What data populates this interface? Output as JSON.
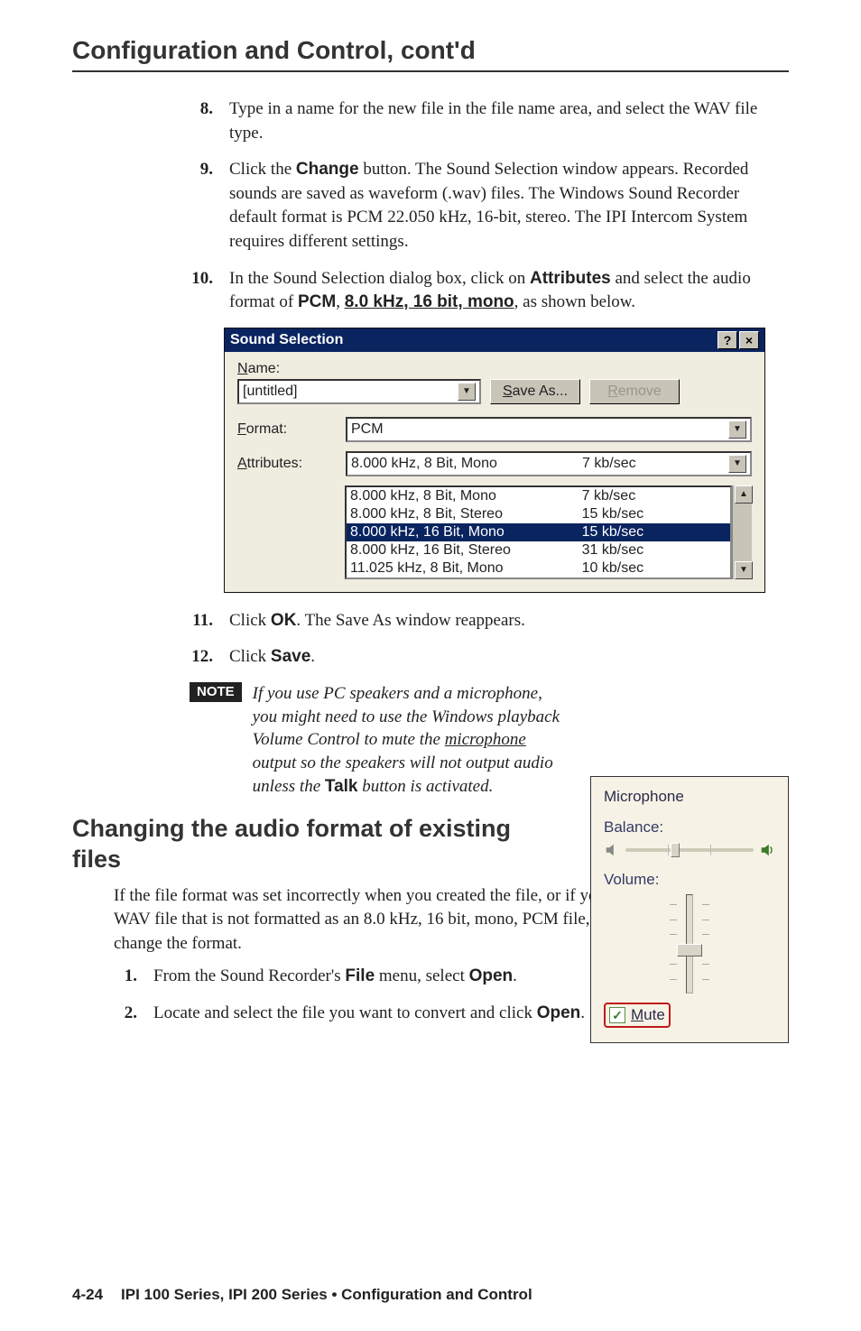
{
  "header": "Configuration and Control, cont'd",
  "steps_a": [
    {
      "num": "8.",
      "text": "Type in a name for the new file in the file name area, and select the WAV file type."
    },
    {
      "num": "9.",
      "pre": "Click the ",
      "bold": "Change",
      "post": " button.  The Sound Selection window appears.  Recorded sounds are saved as waveform (.wav) files.  The Windows Sound Recorder default format is PCM 22.050 kHz, 16-bit, stereo.  The IPI Intercom System requires different settings."
    },
    {
      "num": "10.",
      "pre": "In the Sound Selection dialog box, click on ",
      "bold": "Attributes",
      "mid": " and select the audio format of ",
      "bold2": "PCM",
      "sep": ", ",
      "ubold": "8.0 kHz, 16 bit, mono",
      "post2": ", as shown below."
    }
  ],
  "dialog": {
    "title": "Sound Selection",
    "help": "?",
    "close": "×",
    "name_label_u": "N",
    "name_label_rest": "ame:",
    "name_value": "[untitled]",
    "saveas_u": "S",
    "saveas_rest": "ave As...",
    "remove_u": "R",
    "remove_rest": "emove",
    "format_u": "F",
    "format_rest": "ormat:",
    "format_value": "PCM",
    "attr_u": "A",
    "attr_rest": "ttributes:",
    "attr_value": "8.000 kHz, 8 Bit, Mono",
    "attr_rate": "7 kb/sec",
    "list": [
      {
        "c1": "8.000 kHz, 8 Bit, Mono",
        "c2": "7 kb/sec",
        "sel": false
      },
      {
        "c1": "8.000 kHz, 8 Bit, Stereo",
        "c2": "15 kb/sec",
        "sel": false
      },
      {
        "c1": "8.000 kHz, 16 Bit, Mono",
        "c2": "15 kb/sec",
        "sel": true
      },
      {
        "c1": "8.000 kHz, 16 Bit, Stereo",
        "c2": "31 kb/sec",
        "sel": false
      },
      {
        "c1": "11.025 kHz, 8 Bit, Mono",
        "c2": "10 kb/sec",
        "sel": false
      }
    ]
  },
  "steps_b": [
    {
      "num": "11.",
      "pre": "Click ",
      "bold": "OK",
      "post": ".  The Save As window reappears."
    },
    {
      "num": "12.",
      "pre": "Click ",
      "bold": "Save",
      "post": "."
    }
  ],
  "note": {
    "badge": "NOTE",
    "pre": "If you use PC speakers and a microphone, you might need to use the Windows playback Volume Control to mute the ",
    "u": "microphone",
    "mid": " output so the speakers will not output audio unless the ",
    "bold": "Talk",
    "post": " button is activated."
  },
  "mic": {
    "title": "Microphone",
    "balance": "Balance:",
    "volume": "Volume:",
    "mute_u": "M",
    "mute_rest": "ute",
    "checked": "✓"
  },
  "section": "Changing the audio format of existing files",
  "para": "If the file format was set incorrectly when you created the file, or if you want to use an existing WAV file that is not formatted as an 8.0 kHz, 16 bit, mono, PCM file, follow this procedure to change the format.",
  "steps_c": [
    {
      "num": "1.",
      "pre": "From the Sound Recorder's ",
      "bold": "File",
      "mid": " menu, select ",
      "bold2": "Open",
      "post": "."
    },
    {
      "num": "2.",
      "pre": "Locate and select the file you want to convert and click ",
      "bold": "Open",
      "post": "."
    }
  ],
  "footer": {
    "page": "4-24",
    "title": "IPI 100 Series, IPI 200 Series • Configuration and Control"
  }
}
